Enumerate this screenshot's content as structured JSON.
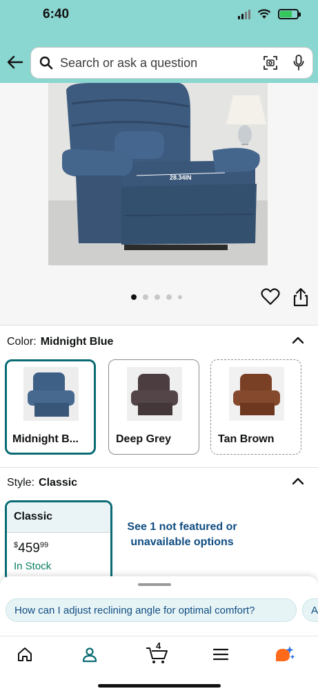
{
  "status_bar": {
    "time": "6:40"
  },
  "search": {
    "placeholder": "Search or ask a question",
    "icons": [
      "back-arrow-icon",
      "search-icon",
      "camera-scan-icon",
      "microphone-icon"
    ]
  },
  "product_image": {
    "measurement_label": "28.34IN",
    "carousel_count": 5,
    "carousel_active": 0
  },
  "color_section": {
    "label": "Color:",
    "selected": "Midnight Blue",
    "options": [
      {
        "label": "Midnight B...",
        "color": "#3e5f86",
        "selected": true
      },
      {
        "label": "Deep Grey",
        "color": "#4b3d40",
        "selected": false
      },
      {
        "label": "Tan Brown",
        "color": "#7a4026",
        "selected": false
      }
    ]
  },
  "style_section": {
    "label": "Style:",
    "selected": "Classic",
    "card": {
      "name": "Classic",
      "price_currency": "$",
      "price_whole": "459",
      "price_fraction": "99",
      "stock": "In Stock"
    },
    "not_featured_text": "See 1 not featured or unavailable options"
  },
  "rufus": {
    "questions": [
      "How can I adjust reclining angle for optimal comfort?",
      "A"
    ]
  },
  "bottom_nav": {
    "items": [
      "home-icon",
      "account-icon",
      "cart-icon",
      "menu-icon",
      "rufus-icon"
    ],
    "cart_count": "4"
  },
  "colors": {
    "header_bg": "#8ad6d0",
    "accent": "#0a6b73",
    "link": "#0f4c81",
    "in_stock": "#067d62"
  }
}
